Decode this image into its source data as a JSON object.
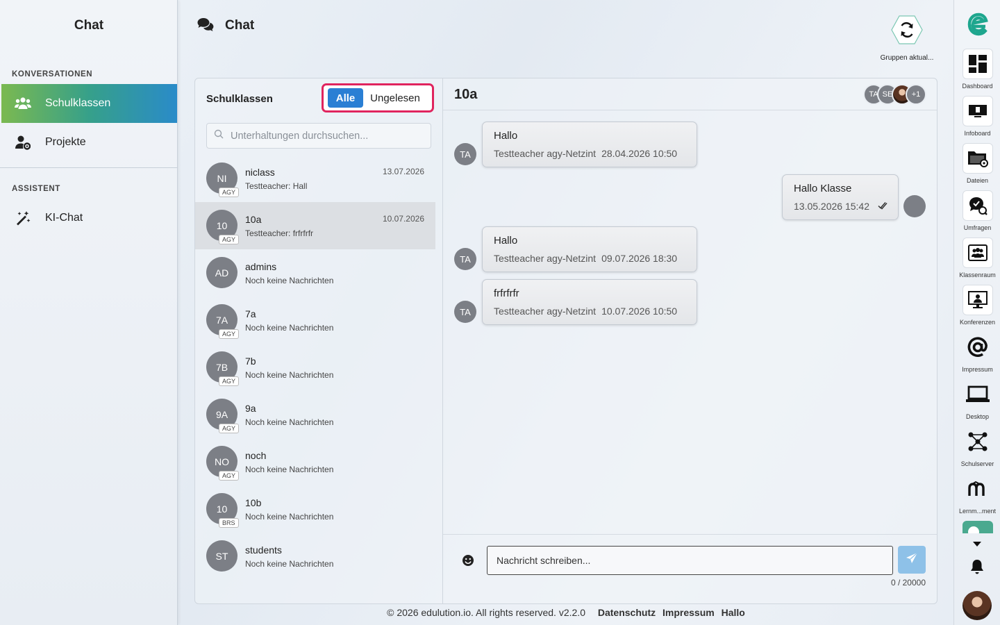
{
  "sidebar": {
    "title": "Chat",
    "section_conversations": "KONVERSATIONEN",
    "section_assistant": "ASSISTENT",
    "items": [
      {
        "label": "Schulklassen",
        "icon": "users-icon"
      },
      {
        "label": "Projekte",
        "icon": "user-gear-icon"
      },
      {
        "label": "KI-Chat",
        "icon": "magic-wand-icon"
      }
    ]
  },
  "header": {
    "title": "Chat",
    "refresh_label": "Gruppen aktual..."
  },
  "conversations": {
    "title": "Schulklassen",
    "filter_all": "Alle",
    "filter_unread": "Ungelesen",
    "search_placeholder": "Unterhaltungen durchsuchen...",
    "items": [
      {
        "initials": "NI",
        "badge": "AGY",
        "name": "niclass",
        "sub": "Testteacher: Hall",
        "date": "13.07.2026"
      },
      {
        "initials": "10",
        "badge": "AGY",
        "name": "10a",
        "sub": "Testteacher: frfrfrfr",
        "date": "10.07.2026"
      },
      {
        "initials": "AD",
        "badge": "",
        "name": "admins",
        "sub": "Noch keine Nachrichten",
        "date": ""
      },
      {
        "initials": "7A",
        "badge": "AGY",
        "name": "7a",
        "sub": "Noch keine Nachrichten",
        "date": ""
      },
      {
        "initials": "7B",
        "badge": "AGY",
        "name": "7b",
        "sub": "Noch keine Nachrichten",
        "date": ""
      },
      {
        "initials": "9A",
        "badge": "AGY",
        "name": "9a",
        "sub": "Noch keine Nachrichten",
        "date": ""
      },
      {
        "initials": "NO",
        "badge": "AGY",
        "name": "noch",
        "sub": "Noch keine Nachrichten",
        "date": ""
      },
      {
        "initials": "10",
        "badge": "BRS",
        "name": "10b",
        "sub": "Noch keine Nachrichten",
        "date": ""
      },
      {
        "initials": "ST",
        "badge": "",
        "name": "students",
        "sub": "Noch keine Nachrichten",
        "date": ""
      }
    ]
  },
  "chat": {
    "title": "10a",
    "participants": [
      "TA",
      "SE",
      "",
      "+1"
    ],
    "messages": [
      {
        "text": "Hallo",
        "author": "Testteacher agy-Netzint",
        "time": "28.04.2026 10:50",
        "avatar": "TA",
        "own": false
      },
      {
        "text": "Hallo Klasse",
        "author": "",
        "time": "13.05.2026 15:42",
        "avatar": "",
        "own": true
      },
      {
        "text": "Hallo",
        "author": "Testteacher agy-Netzint",
        "time": "09.07.2026 18:30",
        "avatar": "TA",
        "own": false
      },
      {
        "text": "frfrfrfr",
        "author": "Testteacher agy-Netzint",
        "time": "10.07.2026 10:50",
        "avatar": "TA",
        "own": false
      }
    ],
    "input_placeholder": "Nachricht schreiben...",
    "counter": "0 / 20000"
  },
  "footer": {
    "copyright": "© 2026 edulution.io. All rights reserved. v2.2.0",
    "links": [
      "Datenschutz",
      "Impressum",
      "Hallo"
    ]
  },
  "rail": {
    "apps": [
      "Dashboard",
      "Infoboard",
      "Dateien",
      "Umfragen",
      "Klassenraum",
      "Konferenzen",
      "Impressum",
      "Desktop",
      "Schulserver",
      "Lernm...ment"
    ]
  },
  "colors": {
    "accent": "#2a7fd4",
    "filter_border": "#e0245e",
    "active_gradient_start": "#7bb950",
    "active_gradient_end": "#2a8bc9"
  }
}
